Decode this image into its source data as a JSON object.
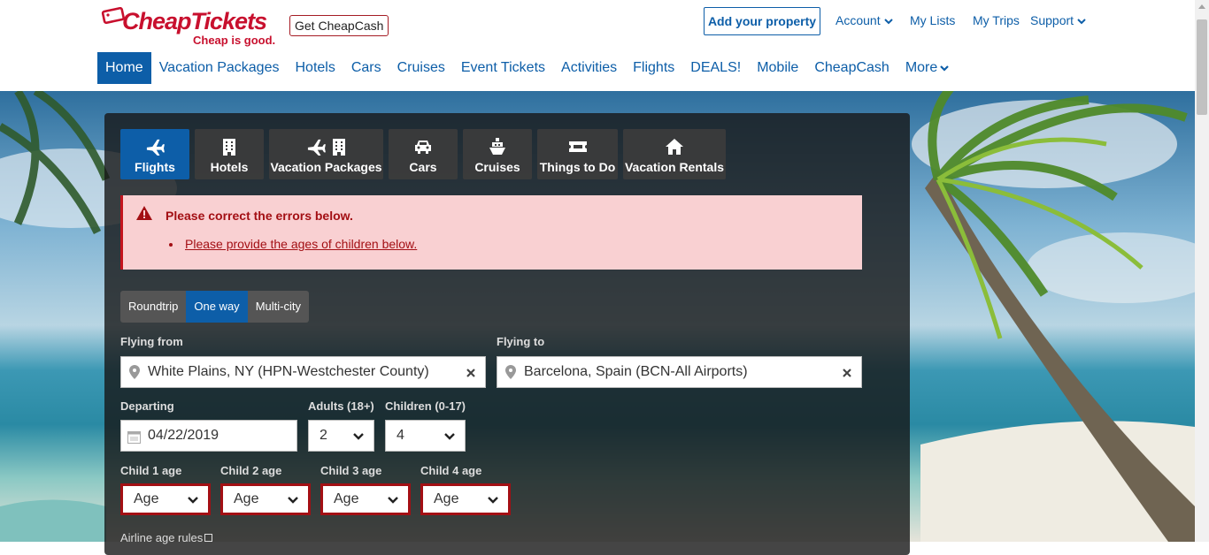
{
  "header": {
    "logo_text": "CheapTickets",
    "slogan": "Cheap is good.",
    "cheapcash_button": "Get CheapCash",
    "add_property": "Add your property",
    "account": "Account",
    "my_lists": "My Lists",
    "my_trips": "My Trips",
    "support": "Support"
  },
  "nav": [
    "Home",
    "Vacation Packages",
    "Hotels",
    "Cars",
    "Cruises",
    "Event Tickets",
    "Activities",
    "Flights",
    "DEALS!",
    "Mobile",
    "CheapCash",
    "More"
  ],
  "tabs": [
    {
      "label": "Flights",
      "icon": "plane-icon"
    },
    {
      "label": "Hotels",
      "icon": "building-icon"
    },
    {
      "label": "Vacation Packages",
      "icon": "plane-building-icon"
    },
    {
      "label": "Cars",
      "icon": "car-icon"
    },
    {
      "label": "Cruises",
      "icon": "ship-icon"
    },
    {
      "label": "Things to Do",
      "icon": "ticket-icon"
    },
    {
      "label": "Vacation Rentals",
      "icon": "house-icon"
    }
  ],
  "error": {
    "title": "Please correct the errors below.",
    "message": "Please provide the ages of children below."
  },
  "trip_types": [
    "Roundtrip",
    "One way",
    "Multi-city"
  ],
  "form": {
    "flying_from_label": "Flying from",
    "flying_from_value": "White Plains, NY (HPN-Westchester County)",
    "flying_to_label": "Flying to",
    "flying_to_value": "Barcelona, Spain (BCN-All Airports)",
    "departing_label": "Departing",
    "departing_value": "04/22/2019",
    "adults_label": "Adults (18+)",
    "adults_value": "2",
    "children_label": "Children (0-17)",
    "children_value": "4",
    "child_ages": [
      {
        "label": "Child 1 age",
        "value": "Age"
      },
      {
        "label": "Child 2 age",
        "value": "Age"
      },
      {
        "label": "Child 3 age",
        "value": "Age"
      },
      {
        "label": "Child 4 age",
        "value": "Age"
      }
    ],
    "age_rules_link": "Airline age rules"
  },
  "colors": {
    "brand_red": "#c8102e",
    "link_blue": "#0d5ea8",
    "error_red": "#a30f14",
    "error_bg": "#f9d0d2"
  }
}
